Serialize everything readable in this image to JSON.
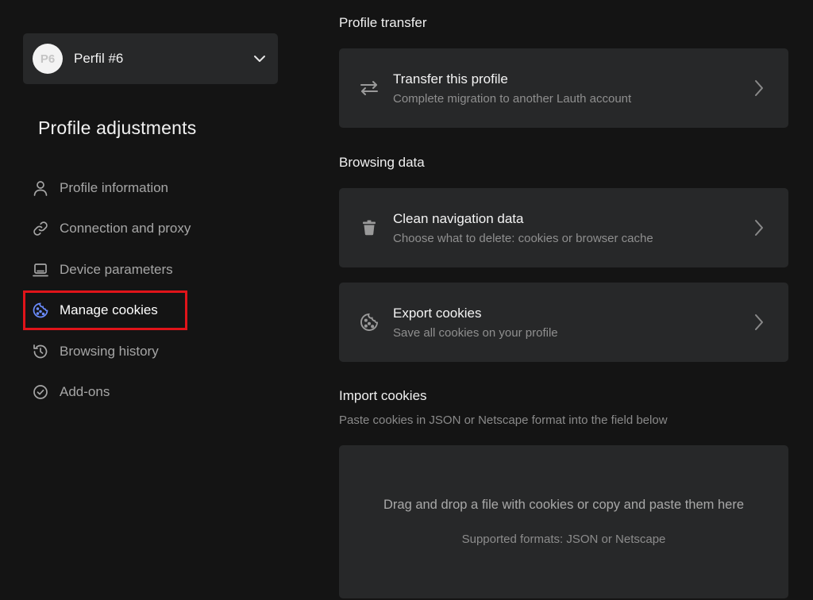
{
  "profile": {
    "avatar_initials": "P6",
    "name": "Perfil #6"
  },
  "sidebar": {
    "title": "Profile adjustments",
    "items": [
      {
        "label": "Profile information",
        "icon": "user-icon"
      },
      {
        "label": "Connection and proxy",
        "icon": "link-icon"
      },
      {
        "label": "Device parameters",
        "icon": "laptop-icon"
      },
      {
        "label": "Manage cookies",
        "icon": "cookie-icon",
        "active": true
      },
      {
        "label": "Browsing history",
        "icon": "history-icon"
      },
      {
        "label": "Add-ons",
        "icon": "check-circle-icon"
      }
    ]
  },
  "sections": {
    "profile_transfer": {
      "title": "Profile transfer",
      "card": {
        "title": "Transfer this profile",
        "subtitle": "Complete migration to another Lauth account",
        "icon": "swap-arrows-icon"
      }
    },
    "browsing_data": {
      "title": "Browsing data",
      "cards": [
        {
          "title": "Clean navigation data",
          "subtitle": "Choose what to delete: cookies or browser cache",
          "icon": "trash-icon"
        },
        {
          "title": "Export cookies",
          "subtitle": "Save all cookies on your profile",
          "icon": "cookie-icon"
        }
      ]
    },
    "import_cookies": {
      "title": "Import cookies",
      "description": "Paste cookies in JSON or Netscape format into the field below",
      "dropzone_text": "Drag and drop a file with cookies or copy and paste them here",
      "formats_text": "Supported formats: JSON or Netscape"
    }
  },
  "colors": {
    "background": "#141414",
    "card": "#272829",
    "active_icon": "#6b8cff",
    "highlight_box": "#e0141a"
  }
}
